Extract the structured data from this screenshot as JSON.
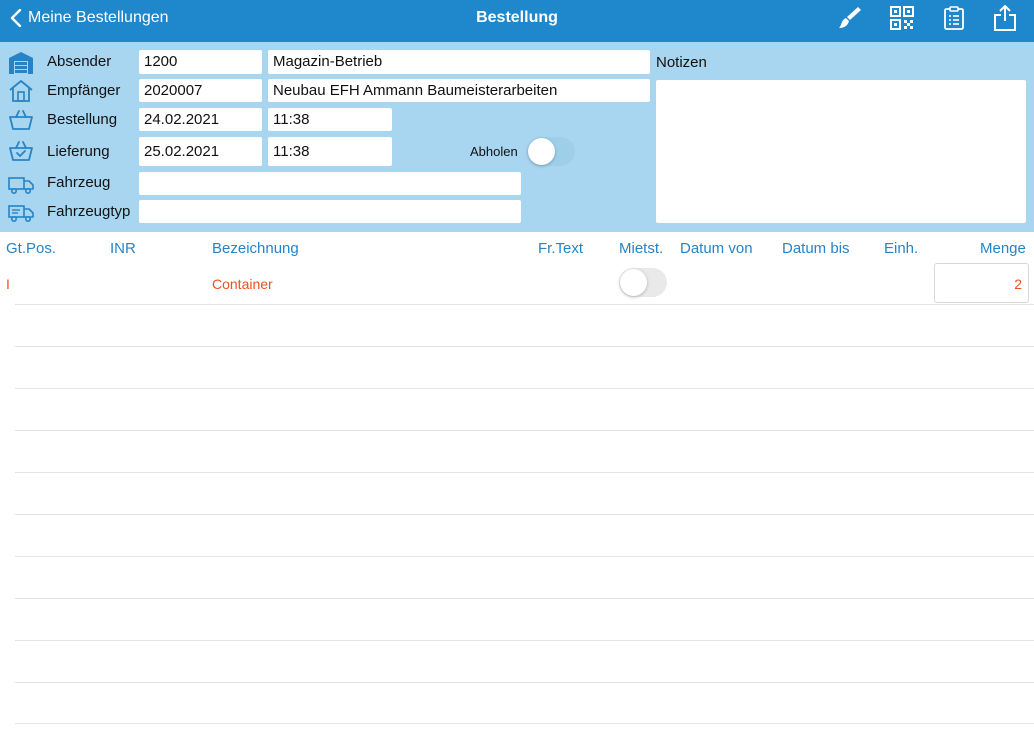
{
  "nav": {
    "back_label": "Meine Bestellungen",
    "title": "Bestellung",
    "icons": [
      "brush-icon",
      "qr-code-icon",
      "clipboard-list-icon",
      "share-icon"
    ]
  },
  "header": {
    "absender": {
      "label": "Absender",
      "code": "1200",
      "name": "Magazin-Betrieb"
    },
    "empfaenger": {
      "label": "Empfänger",
      "code": "2020007",
      "name": "Neubau EFH Ammann Baumeisterarbeiten"
    },
    "bestellung": {
      "label": "Bestellung",
      "date": "24.02.2021",
      "time": "11:38"
    },
    "lieferung": {
      "label": "Lieferung",
      "date": "25.02.2021",
      "time": "11:38"
    },
    "abholen": {
      "label": "Abholen",
      "on": false
    },
    "fahrzeug": {
      "label": "Fahrzeug",
      "value": ""
    },
    "fahrzeugtyp": {
      "label": "Fahrzeugtyp",
      "value": ""
    },
    "notes": {
      "label": "Notizen",
      "value": ""
    }
  },
  "table": {
    "columns": [
      "Gt.Pos.",
      "INR",
      "Bezeichnung",
      "Fr.Text",
      "Mietst.",
      "Datum von",
      "Datum bis",
      "Einh.",
      "Menge"
    ],
    "rows": [
      {
        "gtpos": "I",
        "inr": "",
        "bezeichnung": "Container",
        "frtext": "",
        "mietst": false,
        "datum_von": "",
        "datum_bis": "",
        "einh": "",
        "menge": "2"
      }
    ]
  },
  "colors": {
    "nav_bg": "#1f87cc",
    "header_bg": "#a8d5f0",
    "column_header": "#2684c6",
    "row_text": "#f0501e",
    "toggle_off": "#9ecfe9"
  }
}
